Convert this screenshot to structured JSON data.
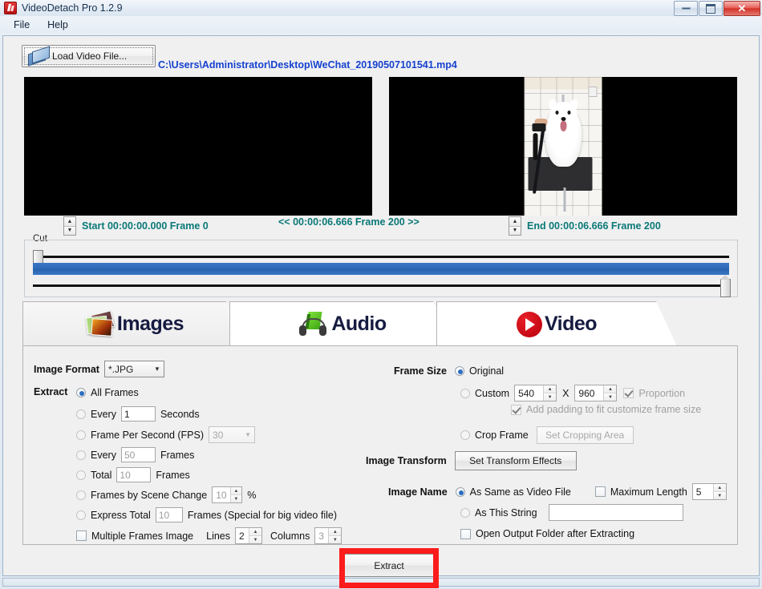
{
  "window": {
    "title": "VideoDetach Pro 1.2.9",
    "app_icon": "app-icon",
    "minimize": "–",
    "maximize": "☐",
    "close": "✕"
  },
  "menu": {
    "items": [
      "File",
      "Help"
    ]
  },
  "toolbar": {
    "load_button": "Load Video File...",
    "file_path": "C:\\Users\\Administrator\\Desktop\\WeChat_20190507101541.mp4"
  },
  "timeline": {
    "start_label": "Start 00:00:00.000  Frame 0",
    "current_label": "<< 00:00:06.666  Frame 200 >>",
    "end_label": "End 00:00:06.666  Frame 200",
    "cut_legend": "Cut"
  },
  "tabs": [
    {
      "label": "Images",
      "icon": "images-icon",
      "active": true
    },
    {
      "label": "Audio",
      "icon": "audio-icon",
      "active": false
    },
    {
      "label": "Video",
      "icon": "video-icon",
      "active": false
    }
  ],
  "images_panel": {
    "image_format_label": "Image Format",
    "image_format_value": "*.JPG",
    "extract_label": "Extract",
    "opt_all_frames": "All Frames",
    "opt_every_seconds_pre": "Every",
    "every_seconds_value": "1",
    "opt_every_seconds_post": "Seconds",
    "opt_fps": "Frame Per Second (FPS)",
    "fps_value": "30",
    "opt_every_frames_pre": "Every",
    "every_frames_value": "50",
    "opt_every_frames_post": "Frames",
    "opt_total_pre": "Total",
    "total_value": "10",
    "opt_total_post": "Frames",
    "opt_scene_change": "Frames by Scene Change",
    "scene_change_value": "10",
    "scene_change_unit": "%",
    "opt_express_total": "Express Total",
    "express_total_value": "10",
    "express_total_post": "Frames (Special for big video file)",
    "multiple_frames_image": "Multiple Frames Image",
    "lines_label": "Lines",
    "lines_value": "2",
    "columns_label": "Columns",
    "columns_value": "3",
    "frame_size_label": "Frame Size",
    "frame_size_original": "Original",
    "frame_size_custom": "Custom",
    "custom_width": "540",
    "custom_x": "X",
    "custom_height": "960",
    "proportion": "Proportion",
    "add_padding": "Add padding to fit customize frame size",
    "crop_frame": "Crop Frame",
    "set_cropping_area": "Set Cropping Area",
    "image_transform_label": "Image Transform",
    "set_transform_effects": "Set Transform Effects",
    "image_name_label": "Image Name",
    "name_as_video_file": "As Same as Video File",
    "maximum_length": "Maximum Length",
    "maximum_length_value": "5",
    "name_as_this_string": "As This String",
    "name_string_value": "",
    "open_output_folder": "Open Output Folder after Extracting"
  },
  "footer": {
    "extract_button": "Extract"
  },
  "colors": {
    "file_path_blue": "#1642d0",
    "timeline_teal": "#0b7878",
    "highlight_red": "#fc1c1c",
    "selection_blue": "#2d6ab9"
  }
}
